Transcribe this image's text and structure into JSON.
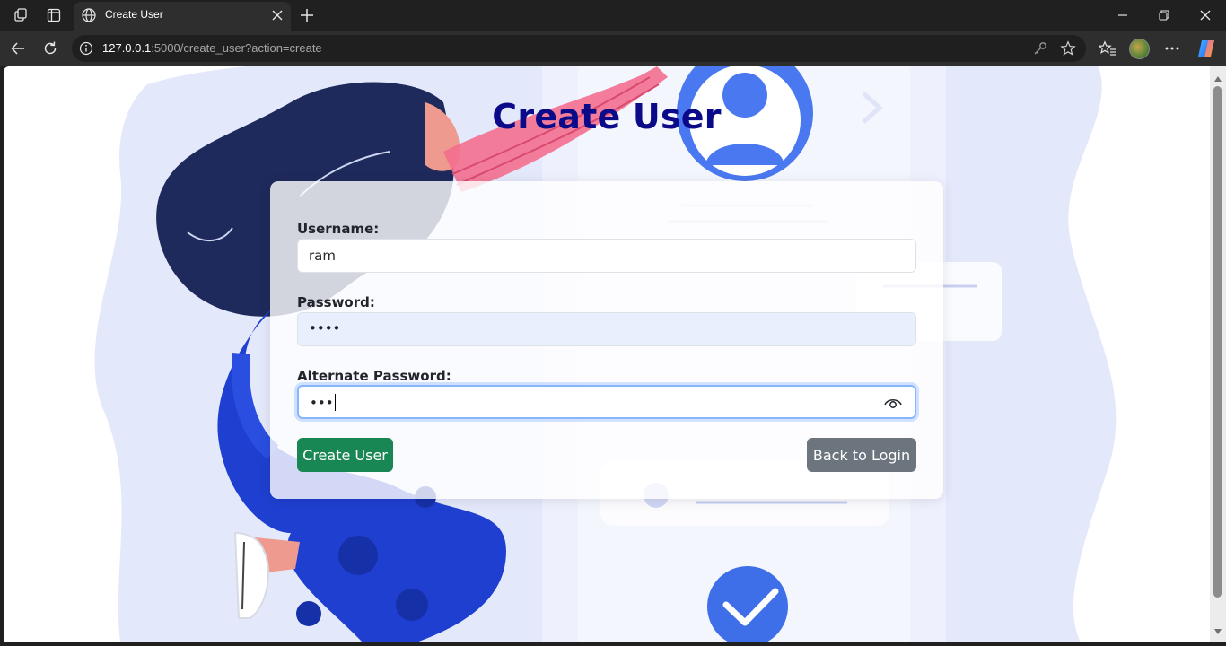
{
  "browser": {
    "tab_title": "Create User",
    "url_host": "127.0.0.1",
    "url_rest": ":5000/create_user?action=create"
  },
  "page": {
    "title": "Create User",
    "form": {
      "username_label": "Username:",
      "username_value": "ram",
      "password_label": "Password:",
      "password_mask": "••••",
      "alt_password_label": "Alternate Password:",
      "alt_password_mask": "•••"
    },
    "buttons": {
      "create": "Create User",
      "back": "Back to Login"
    }
  },
  "colors": {
    "title": "#0b0b8a",
    "create_button": "#198754",
    "back_button": "#6c757d",
    "autofill_bg": "#e8f0fe",
    "focus_ring": "#86b7fe"
  },
  "icons": [
    "workspaces-icon",
    "tab-actions-icon",
    "globe-icon",
    "close-icon",
    "plus-icon",
    "minimize-icon",
    "restore-icon",
    "back-arrow-icon",
    "refresh-icon",
    "info-icon",
    "key-icon",
    "star-icon",
    "favorites-icon",
    "more-icon",
    "copilot-icon",
    "eye-icon"
  ]
}
